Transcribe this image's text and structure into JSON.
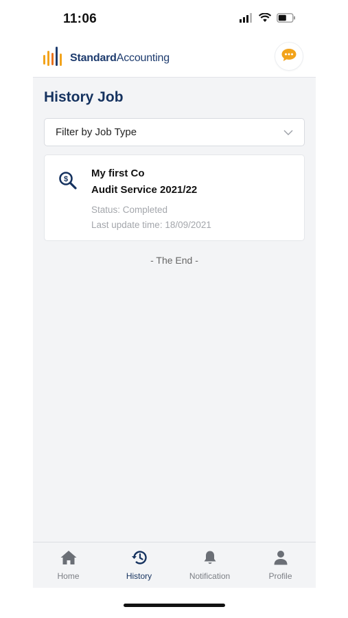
{
  "status_bar": {
    "time": "11:06"
  },
  "header": {
    "brand_bold": "Standard",
    "brand_regular": "Accounting",
    "logo_icon": "bar-chart-logo",
    "chat_icon": "chat-bubble-icon",
    "accent_color": "#f2a31b"
  },
  "page": {
    "title": "History Job"
  },
  "filter": {
    "placeholder": "Filter by Job Type"
  },
  "jobs": [
    {
      "company": "My first Co",
      "service": "Audit Service 2021/22",
      "status": "Status: Completed",
      "updated": "Last update time: 18/09/2021",
      "icon": "dollar-search-icon"
    }
  ],
  "end_label": "- The End -",
  "tabs": [
    {
      "label": "Home",
      "icon": "home-icon",
      "active": false
    },
    {
      "label": "History",
      "icon": "history-icon",
      "active": true
    },
    {
      "label": "Notification",
      "icon": "bell-icon",
      "active": false
    },
    {
      "label": "Profile",
      "icon": "person-icon",
      "active": false
    }
  ],
  "colors": {
    "primary": "#15325f",
    "background": "#f3f4f6",
    "muted_text": "#a3a6ab"
  }
}
